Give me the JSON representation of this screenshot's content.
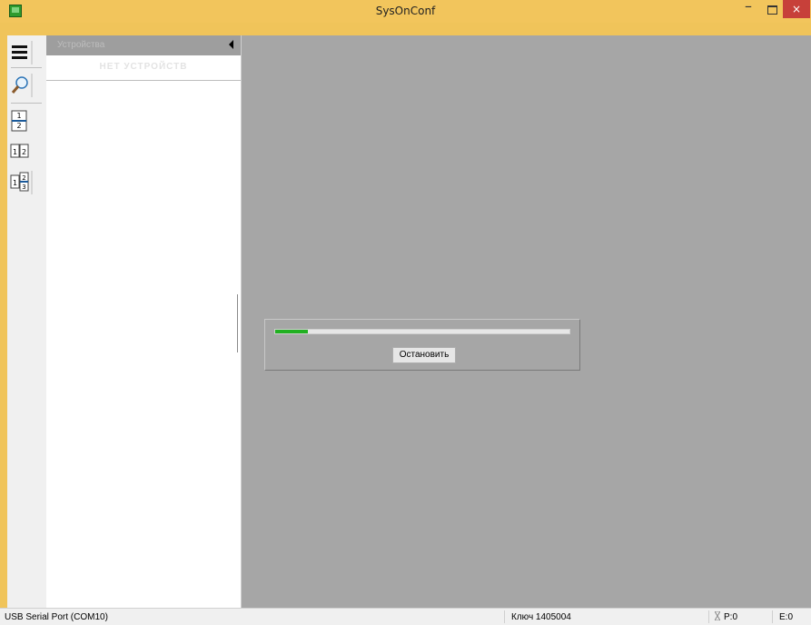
{
  "window": {
    "title": "SysOnConf",
    "minimize": "–",
    "close": "×"
  },
  "toolbar": {
    "items": [
      "menu-icon",
      "search-icon",
      "layout-1-2-icon",
      "layout-1-2-split-icon",
      "layout-1-2-3-icon"
    ]
  },
  "devices_panel": {
    "title": "Устройства",
    "empty_text": "НЕТ УСТРОЙСТВ"
  },
  "progress_dialog": {
    "progress": 0.11,
    "stop_label": "Остановить"
  },
  "statusbar": {
    "port": "USB Serial Port (COM10)",
    "key": "Ключ 1405004",
    "p": "P:0",
    "e": "E:0"
  },
  "colors": {
    "titlebar": "#f2c55c",
    "workspace": "#a6a6a6",
    "progress": "#21b021",
    "close": "#c7403a"
  }
}
